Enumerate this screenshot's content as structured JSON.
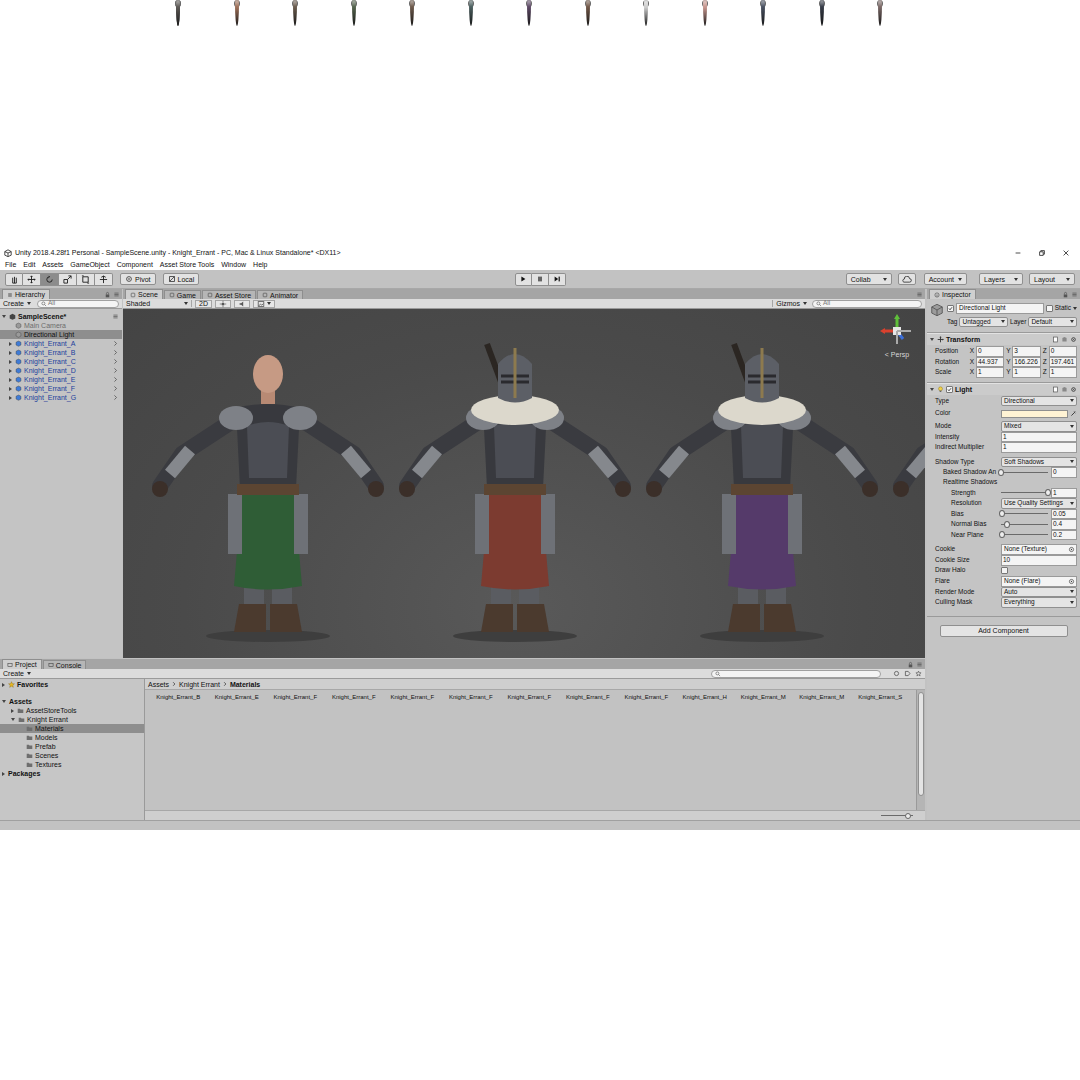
{
  "window": {
    "title": "Unity 2018.4.28f1 Personal - SampleScene.unity - Knight_Errant - PC, Mac & Linux Standalone* <DX11>"
  },
  "menu": [
    "File",
    "Edit",
    "Assets",
    "GameObject",
    "Component",
    "Asset Store Tools",
    "Window",
    "Help"
  ],
  "toolbar": {
    "tools": [
      {
        "selected": false
      },
      {
        "selected": false
      },
      {
        "selected": true
      },
      {
        "selected": false
      },
      {
        "selected": false
      },
      {
        "selected": false
      }
    ],
    "pivot": "Pivot",
    "space": "Local",
    "collab": "Collab",
    "account": "Account",
    "layers": "Layers",
    "layout": "Layout"
  },
  "hierarchy": {
    "tab": "Hierarchy",
    "create": "Create",
    "search": {
      "placeholder": "All"
    },
    "scene": {
      "name": "SampleScene*",
      "expanded": true
    },
    "items": [
      {
        "label": "Main Camera",
        "kind": "object",
        "active": false,
        "selected": false,
        "expanded": false
      },
      {
        "label": "Directional Light",
        "kind": "object",
        "active": true,
        "selected": true,
        "expanded": false
      },
      {
        "label": "Knight_Errant_A",
        "kind": "prefab",
        "active": true,
        "selected": false,
        "expanded": false
      },
      {
        "label": "Knight_Errant_B",
        "kind": "prefab",
        "active": true,
        "selected": false,
        "expanded": false
      },
      {
        "label": "Knight_Errant_C",
        "kind": "prefab",
        "active": true,
        "selected": false,
        "expanded": false
      },
      {
        "label": "Knight_Errant_D",
        "kind": "prefab",
        "active": true,
        "selected": false,
        "expanded": false
      },
      {
        "label": "Knight_Errant_E",
        "kind": "prefab",
        "active": true,
        "selected": false,
        "expanded": false
      },
      {
        "label": "Knight_Errant_F",
        "kind": "prefab",
        "active": true,
        "selected": false,
        "expanded": false
      },
      {
        "label": "Knight_Errant_G",
        "kind": "prefab",
        "active": true,
        "selected": false,
        "expanded": false
      }
    ]
  },
  "scene_view": {
    "tabs": [
      {
        "label": "Scene",
        "selected": true
      },
      {
        "label": "Game",
        "selected": false
      },
      {
        "label": "Asset Store",
        "selected": false
      },
      {
        "label": "Animator",
        "selected": false
      }
    ],
    "shading": "Shaded",
    "toggle_2d": {
      "label": "2D",
      "on": false
    },
    "gizmos": "Gizmos",
    "search": {
      "placeholder": "All"
    },
    "projection": "< Persp",
    "knights": [
      {
        "helmet": false,
        "color": "#2f5d36"
      },
      {
        "helmet": true,
        "color": "#7c3b30"
      },
      {
        "helmet": true,
        "color": "#553a6a"
      },
      {
        "helmet": true,
        "color": "#2e5656"
      }
    ]
  },
  "inspector": {
    "tab": "Inspector",
    "object": {
      "active": true,
      "name": "Directional Light",
      "static_label": "Static",
      "static": false
    },
    "tag": {
      "label": "Tag",
      "value": "Untagged"
    },
    "layer": {
      "label": "Layer",
      "value": "Default"
    },
    "transform": {
      "title": "Transform",
      "expanded": true,
      "axes": [
        "X",
        "Y",
        "Z"
      ],
      "rows": [
        {
          "label": "Position",
          "values": [
            "0",
            "3",
            "0"
          ]
        },
        {
          "label": "Rotation",
          "values": [
            "44.937",
            "166.226",
            "197.461"
          ]
        },
        {
          "label": "Scale",
          "values": [
            "1",
            "1",
            "1"
          ]
        }
      ]
    },
    "light": {
      "title": "Light",
      "enabled": true,
      "expanded": true,
      "groups": [
        [
          {
            "kind": "dropdown",
            "label": "Type",
            "value": "Directional",
            "depth": 0
          },
          {
            "kind": "color",
            "label": "Color",
            "color": "#fff3d4",
            "depth": 0
          },
          {
            "kind": "dropdown",
            "label": "Mode",
            "value": "Mixed",
            "depth": 0
          },
          {
            "kind": "field",
            "label": "Intensity",
            "value": "1",
            "depth": 0
          },
          {
            "kind": "field",
            "label": "Indirect Multiplier",
            "value": "1",
            "depth": 0
          }
        ],
        [
          {
            "kind": "dropdown",
            "label": "Shadow Type",
            "value": "Soft Shadows",
            "depth": 0
          },
          {
            "kind": "slider",
            "label": "Baked Shadow An",
            "value": "0",
            "level": 0,
            "depth": 1
          },
          {
            "kind": "header",
            "label": "Realtime Shadows",
            "depth": 1
          },
          {
            "kind": "slider",
            "label": "Strength",
            "value": "1",
            "level": 1,
            "depth": 2
          },
          {
            "kind": "dropdown",
            "label": "Resolution",
            "value": "Use Quality Settings",
            "depth": 2
          },
          {
            "kind": "slider",
            "label": "Bias",
            "value": "0.05",
            "level": 0.03,
            "depth": 2
          },
          {
            "kind": "slider",
            "label": "Normal Bias",
            "value": "0.4",
            "level": 0.13,
            "depth": 2
          },
          {
            "kind": "slider",
            "label": "Near Plane",
            "value": "0.2",
            "level": 0.02,
            "depth": 2
          }
        ],
        [
          {
            "kind": "object",
            "label": "Cookie",
            "value": "None (Texture)",
            "depth": 0
          },
          {
            "kind": "field",
            "label": "Cookie Size",
            "value": "10",
            "depth": 0
          },
          {
            "kind": "checkbox",
            "label": "Draw Halo",
            "checked": false,
            "depth": 0
          },
          {
            "kind": "object",
            "label": "Flare",
            "value": "None (Flare)",
            "depth": 0
          },
          {
            "kind": "dropdown",
            "label": "Render Mode",
            "value": "Auto",
            "depth": 0
          },
          {
            "kind": "dropdown",
            "label": "Culling Mask",
            "value": "Everything",
            "depth": 0
          }
        ]
      ]
    },
    "add_component": "Add Component"
  },
  "project": {
    "tabs": [
      {
        "label": "Project",
        "selected": true
      },
      {
        "label": "Console",
        "selected": false
      }
    ],
    "create": "Create",
    "search": {
      "placeholder": ""
    },
    "tree": [
      {
        "label": "Favorites",
        "kind": "favorites",
        "depth": 0,
        "expanded": false,
        "has_children": true,
        "selected": false
      },
      {
        "label": "Assets",
        "kind": "root",
        "depth": 0,
        "expanded": true,
        "has_children": true,
        "selected": false
      },
      {
        "label": "AssetStoreTools",
        "kind": "folder",
        "depth": 1,
        "expanded": false,
        "has_children": true,
        "selected": false
      },
      {
        "label": "Knight Errant",
        "kind": "folder",
        "depth": 1,
        "expanded": true,
        "has_children": true,
        "selected": false
      },
      {
        "label": "Materials",
        "kind": "folder",
        "depth": 2,
        "expanded": false,
        "has_children": false,
        "selected": true
      },
      {
        "label": "Models",
        "kind": "folder",
        "depth": 2,
        "expanded": false,
        "has_children": false,
        "selected": false
      },
      {
        "label": "Prefab",
        "kind": "folder",
        "depth": 2,
        "expanded": false,
        "has_children": false,
        "selected": false
      },
      {
        "label": "Scenes",
        "kind": "folder",
        "depth": 2,
        "expanded": false,
        "has_children": false,
        "selected": false
      },
      {
        "label": "Textures",
        "kind": "folder",
        "depth": 2,
        "expanded": false,
        "has_children": false,
        "selected": false
      },
      {
        "label": "Packages",
        "kind": "root",
        "depth": 0,
        "expanded": false,
        "has_children": true,
        "selected": false
      }
    ],
    "breadcrumb": [
      "Assets",
      "Knight Errant",
      "Materials"
    ],
    "materials": [
      {
        "label": "Knight_Errant_B",
        "color": "#474c56"
      },
      {
        "label": "Knight_Errant_E",
        "color": "#a0725a"
      },
      {
        "label": "Knight_Errant_F",
        "color": "#6b5c4e"
      },
      {
        "label": "Knight_Errant_F",
        "color": "#55644e"
      },
      {
        "label": "Knight_Errant_F",
        "color": "#6e5a4c"
      },
      {
        "label": "Knight_Errant_F",
        "color": "#4c6060"
      },
      {
        "label": "Knight_Errant_F",
        "color": "#5e4a66"
      },
      {
        "label": "Knight_Errant_F",
        "color": "#725848"
      },
      {
        "label": "Knight_Errant_F",
        "color": "#d0d0d0"
      },
      {
        "label": "Knight_Errant_H",
        "color": "#c99890"
      },
      {
        "label": "Knight_Errant_M",
        "color": "#4a5262"
      },
      {
        "label": "Knight_Errant_M",
        "color": "#363c48"
      },
      {
        "label": "Knight_Errant_S",
        "color": "#7c6a68"
      },
      {
        "color": "#5e5a56"
      }
    ],
    "zoom_level": 0.85,
    "scroll_level": 0.9
  }
}
